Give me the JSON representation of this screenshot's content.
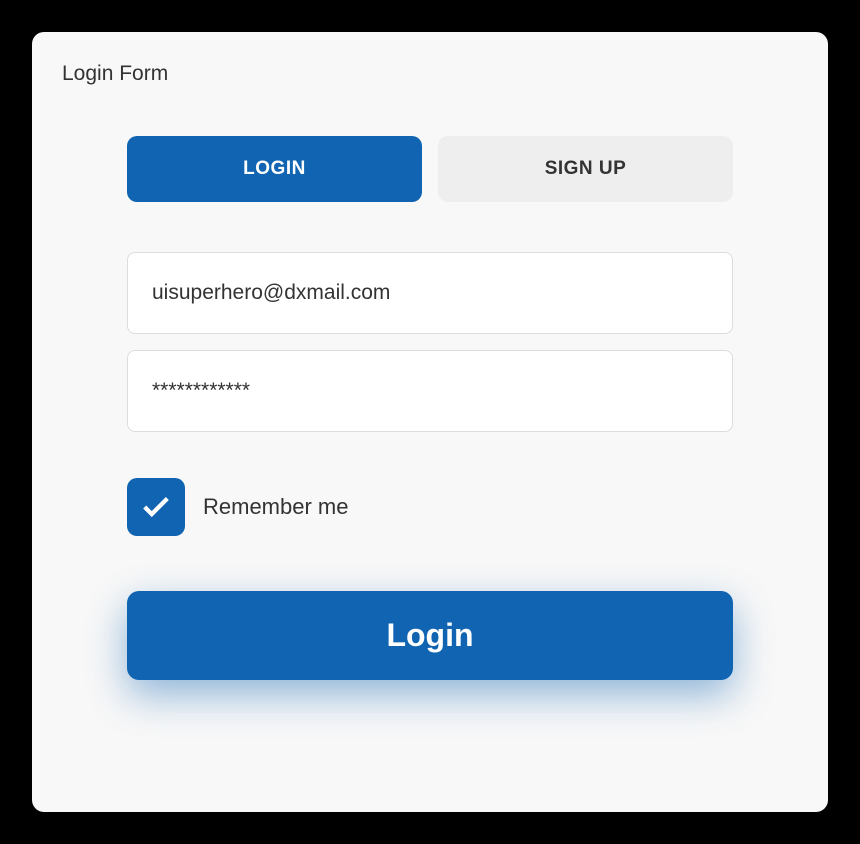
{
  "card": {
    "title": "Login Form"
  },
  "tabs": {
    "login": "LOGIN",
    "signup": "SIGN UP"
  },
  "fields": {
    "email": "uisuperhero@dxmail.com",
    "password": "************"
  },
  "checkbox": {
    "label": "Remember me",
    "checked": true
  },
  "submit": {
    "label": "Login"
  }
}
